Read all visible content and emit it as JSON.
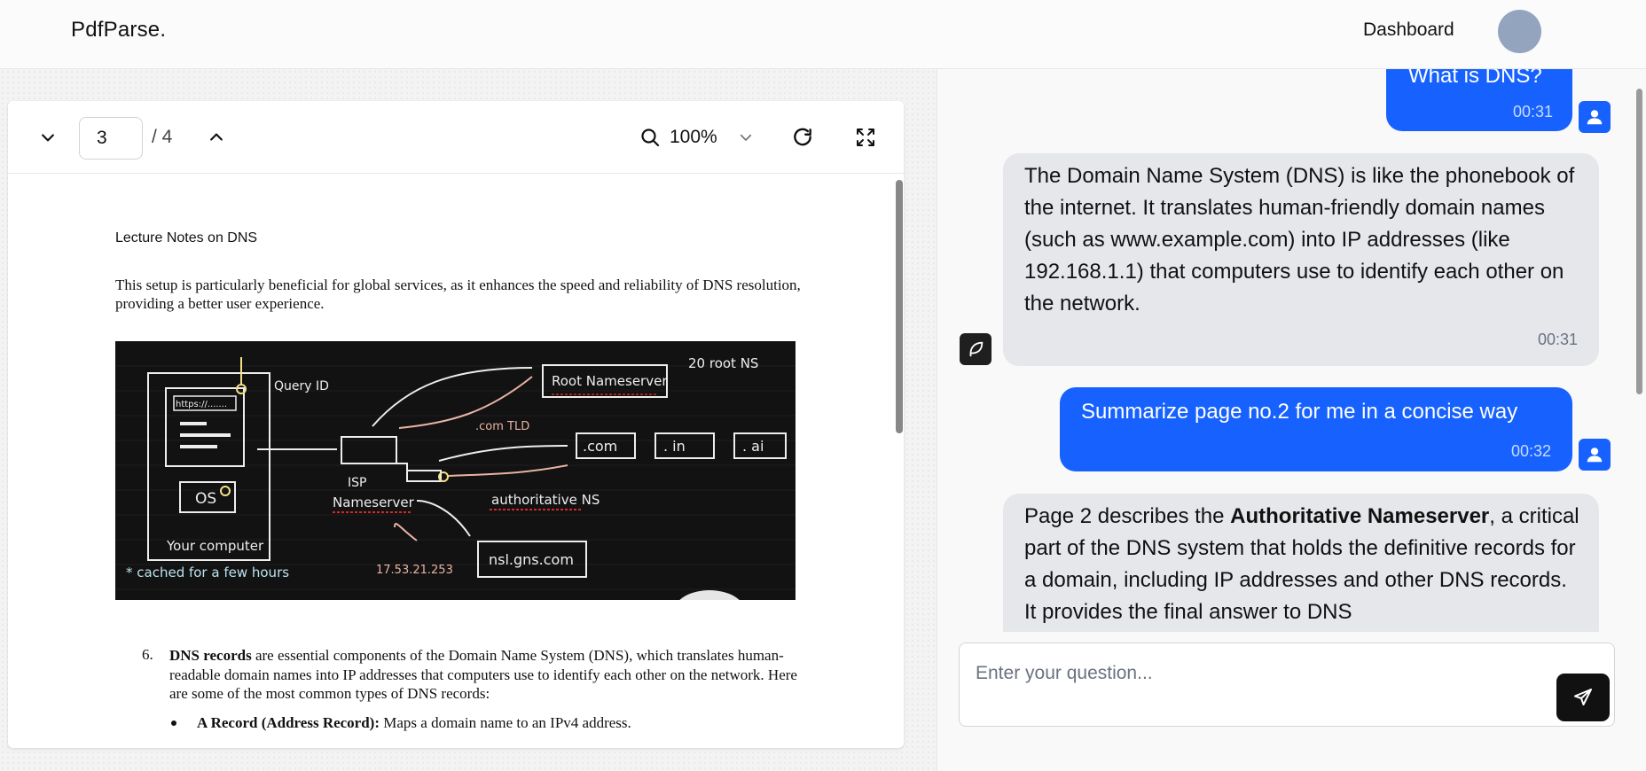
{
  "nav": {
    "brand": "PdfParse.",
    "dashboard_label": "Dashboard"
  },
  "viewer": {
    "current_page": "3",
    "page_total": "/ 4",
    "zoom": "100%"
  },
  "document": {
    "header": "Lecture Notes on DNS",
    "paragraph": "This setup is particularly beneficial for global services, as it enhances the speed and reliability of DNS resolution, providing a better user experience.",
    "figure_labels": {
      "root_count": "20 root NS",
      "root_ns": "Root Nameserver",
      "query": "Query ID",
      "url": "https://.......",
      "os": "OS",
      "com_tld": ".com TLD",
      "com": ".com",
      "in": ". in",
      "ai": ". ai",
      "isp": "ISP",
      "isp_ns": "Nameserver",
      "auth_ns": "authoritative NS",
      "your_computer": "Your computer",
      "cached": "* cached for a few hours",
      "ip": "17.53.21.253",
      "nsl": "nsl.gns.com"
    },
    "list_number": "6.",
    "list_bold": "DNS records",
    "list_text": " are essential components of the Domain Name System (DNS), which translates human-readable domain names into IP addresses that computers use to identify each other on the network. Here are some of the most common types of DNS records:",
    "bullet_bold": "A Record (Address Record):",
    "bullet_text": " Maps a domain name to an IPv4 address."
  },
  "chat": {
    "messages": [
      {
        "role": "user",
        "text": "What is DNS?",
        "time": "00:31"
      },
      {
        "role": "assistant",
        "text": "The Domain Name System (DNS) is like the phonebook of the internet. It translates human-friendly domain names (such as www.example.com) into IP addresses (like 192.168.1.1) that computers use to identify each other on the network.",
        "time": "00:31"
      },
      {
        "role": "user",
        "text": "Summarize page no.2 for me in a concise way",
        "time": "00:32"
      },
      {
        "role": "assistant",
        "text_before": "Page 2 describes the ",
        "text_bold": "Authoritative Nameserver",
        "text_after": ", a critical part of the DNS system that holds the definitive records for a domain, including IP addresses and other DNS records. It provides the final answer to DNS"
      }
    ],
    "input_placeholder": "Enter your question..."
  },
  "colors": {
    "accent": "#1762ff",
    "bot_bubble": "#e5e7eb",
    "avatar": "#93a4bf"
  }
}
